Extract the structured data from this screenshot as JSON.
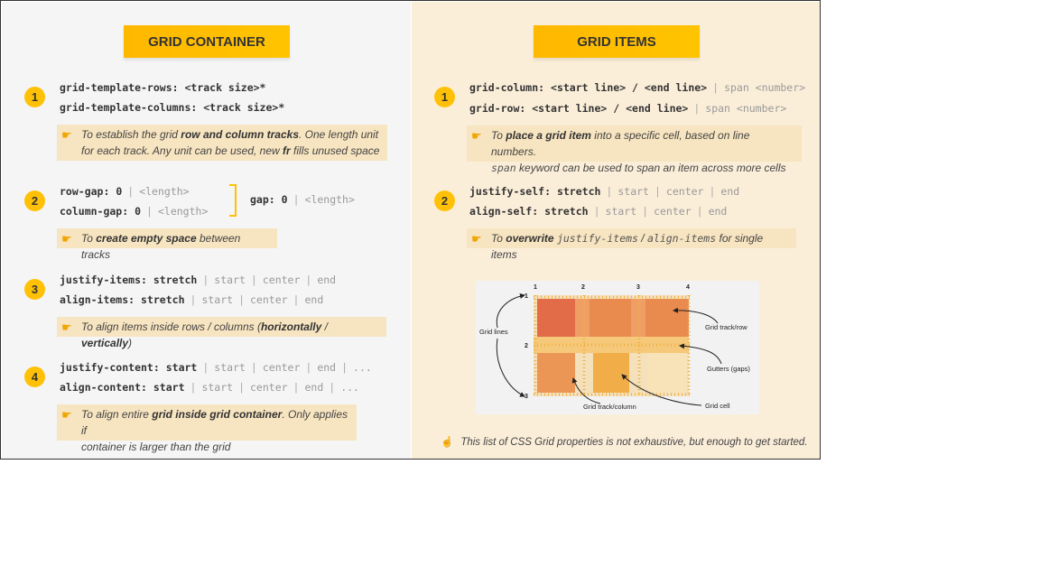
{
  "left": {
    "title": "GRID CONTAINER",
    "sections": [
      {
        "num": "1",
        "code": [
          "grid-template-rows: <track size>*",
          "grid-template-columns: <track size>*"
        ],
        "note": {
          "pre": "To establish the grid ",
          "bold": "row and column tracks",
          "mid": ". One length unit",
          "line2_pre": "for each track. Any unit can be used, new ",
          "line2_bold": "fr",
          "line2_post": " fills unused space"
        }
      },
      {
        "num": "2",
        "row_gap": {
          "prop": "row-gap:",
          "val": "0",
          "alt": "<length>"
        },
        "col_gap": {
          "prop": "column-gap:",
          "val": "0",
          "alt": "<length>"
        },
        "gap": {
          "prop": "gap:",
          "val": "0",
          "alt": "<length>"
        },
        "note": {
          "pre": "To ",
          "bold": "create empty space",
          "post": " between tracks"
        }
      },
      {
        "num": "3",
        "lines": [
          {
            "prop": "justify-items:",
            "val": "stretch",
            "opts": [
              "start",
              "center",
              "end"
            ]
          },
          {
            "prop": "align-items:",
            "val": "stretch",
            "opts": [
              "start",
              "center",
              "end"
            ]
          }
        ],
        "note": {
          "pre": "To align items inside rows / columns (",
          "bold1": "horizontally",
          "sep": " / ",
          "bold2": "vertically",
          "post": ")"
        }
      },
      {
        "num": "4",
        "lines": [
          {
            "prop": "justify-content:",
            "val": "start",
            "opts": [
              "start",
              "center",
              "end",
              "..."
            ]
          },
          {
            "prop": "align-content:",
            "val": "start",
            "opts": [
              "start",
              "center",
              "end",
              "..."
            ]
          }
        ],
        "note": {
          "pre": "To align entire ",
          "bold": "grid inside grid container",
          "post": ". Only applies if",
          "line2": "container is larger than the grid"
        }
      }
    ]
  },
  "right": {
    "title": "GRID ITEMS",
    "sections": [
      {
        "num": "1",
        "lines": [
          {
            "prop": "grid-column:",
            "val": "<start line> / <end line>",
            "alt": "span <number>"
          },
          {
            "prop": "grid-row:",
            "val": "<start line> / <end line>",
            "alt": "span <number>"
          }
        ],
        "note": {
          "pre": "To ",
          "bold": "place a grid item",
          "post": " into a specific cell, based on line numbers.",
          "line2_mono": "span",
          "line2_post": " keyword can be used to span an item across more cells"
        }
      },
      {
        "num": "2",
        "lines": [
          {
            "prop": "justify-self:",
            "val": "stretch",
            "opts": [
              "start",
              "center",
              "end"
            ]
          },
          {
            "prop": "align-self:",
            "val": "stretch",
            "opts": [
              "start",
              "center",
              "end"
            ]
          }
        ],
        "note": {
          "pre": "To ",
          "bold": "overwrite",
          "mono1": "justify-items",
          "sep": " / ",
          "mono2": "align-items",
          "post": " for single items"
        }
      }
    ],
    "diagram": {
      "col_lines": [
        "1",
        "2",
        "3",
        "4"
      ],
      "row_lines": [
        "1",
        "2",
        "3"
      ],
      "labels": {
        "grid_lines": "Grid lines",
        "track_row": "Grid track/row",
        "gutters": "Gutters (gaps)",
        "track_column": "Grid track/column",
        "cell": "Grid cell"
      }
    },
    "footer": "This list of CSS Grid properties is not exhaustive, but enough to get started."
  },
  "colors": {
    "accent": "#ffc107",
    "left_bg": "#f5f5f5",
    "right_bg": "#fbeed9",
    "note_bg": "#f7e4c0"
  }
}
